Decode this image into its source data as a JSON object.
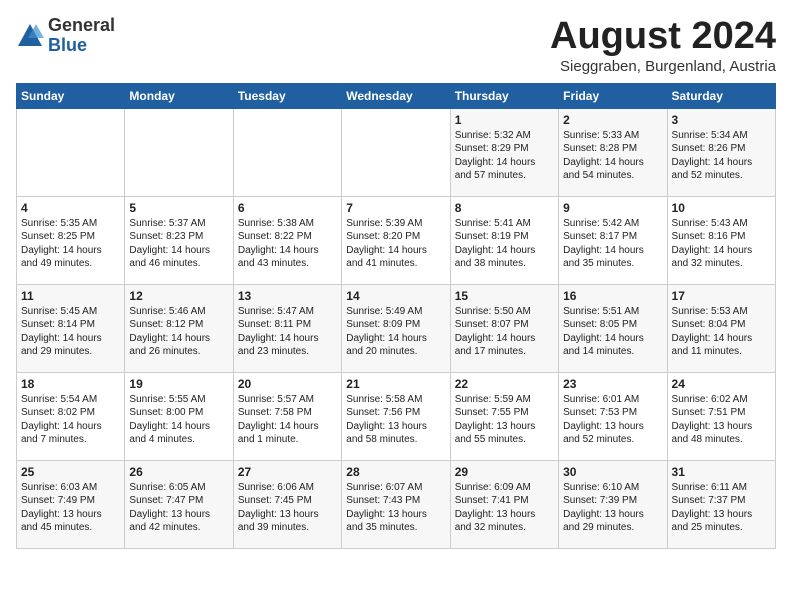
{
  "header": {
    "logo_general": "General",
    "logo_blue": "Blue",
    "month_title": "August 2024",
    "location": "Sieggraben, Burgenland, Austria"
  },
  "weekdays": [
    "Sunday",
    "Monday",
    "Tuesday",
    "Wednesday",
    "Thursday",
    "Friday",
    "Saturday"
  ],
  "weeks": [
    [
      {
        "day": "",
        "content": ""
      },
      {
        "day": "",
        "content": ""
      },
      {
        "day": "",
        "content": ""
      },
      {
        "day": "",
        "content": ""
      },
      {
        "day": "1",
        "content": "Sunrise: 5:32 AM\nSunset: 8:29 PM\nDaylight: 14 hours and 57 minutes."
      },
      {
        "day": "2",
        "content": "Sunrise: 5:33 AM\nSunset: 8:28 PM\nDaylight: 14 hours and 54 minutes."
      },
      {
        "day": "3",
        "content": "Sunrise: 5:34 AM\nSunset: 8:26 PM\nDaylight: 14 hours and 52 minutes."
      }
    ],
    [
      {
        "day": "4",
        "content": "Sunrise: 5:35 AM\nSunset: 8:25 PM\nDaylight: 14 hours and 49 minutes."
      },
      {
        "day": "5",
        "content": "Sunrise: 5:37 AM\nSunset: 8:23 PM\nDaylight: 14 hours and 46 minutes."
      },
      {
        "day": "6",
        "content": "Sunrise: 5:38 AM\nSunset: 8:22 PM\nDaylight: 14 hours and 43 minutes."
      },
      {
        "day": "7",
        "content": "Sunrise: 5:39 AM\nSunset: 8:20 PM\nDaylight: 14 hours and 41 minutes."
      },
      {
        "day": "8",
        "content": "Sunrise: 5:41 AM\nSunset: 8:19 PM\nDaylight: 14 hours and 38 minutes."
      },
      {
        "day": "9",
        "content": "Sunrise: 5:42 AM\nSunset: 8:17 PM\nDaylight: 14 hours and 35 minutes."
      },
      {
        "day": "10",
        "content": "Sunrise: 5:43 AM\nSunset: 8:16 PM\nDaylight: 14 hours and 32 minutes."
      }
    ],
    [
      {
        "day": "11",
        "content": "Sunrise: 5:45 AM\nSunset: 8:14 PM\nDaylight: 14 hours and 29 minutes."
      },
      {
        "day": "12",
        "content": "Sunrise: 5:46 AM\nSunset: 8:12 PM\nDaylight: 14 hours and 26 minutes."
      },
      {
        "day": "13",
        "content": "Sunrise: 5:47 AM\nSunset: 8:11 PM\nDaylight: 14 hours and 23 minutes."
      },
      {
        "day": "14",
        "content": "Sunrise: 5:49 AM\nSunset: 8:09 PM\nDaylight: 14 hours and 20 minutes."
      },
      {
        "day": "15",
        "content": "Sunrise: 5:50 AM\nSunset: 8:07 PM\nDaylight: 14 hours and 17 minutes."
      },
      {
        "day": "16",
        "content": "Sunrise: 5:51 AM\nSunset: 8:05 PM\nDaylight: 14 hours and 14 minutes."
      },
      {
        "day": "17",
        "content": "Sunrise: 5:53 AM\nSunset: 8:04 PM\nDaylight: 14 hours and 11 minutes."
      }
    ],
    [
      {
        "day": "18",
        "content": "Sunrise: 5:54 AM\nSunset: 8:02 PM\nDaylight: 14 hours and 7 minutes."
      },
      {
        "day": "19",
        "content": "Sunrise: 5:55 AM\nSunset: 8:00 PM\nDaylight: 14 hours and 4 minutes."
      },
      {
        "day": "20",
        "content": "Sunrise: 5:57 AM\nSunset: 7:58 PM\nDaylight: 14 hours and 1 minute."
      },
      {
        "day": "21",
        "content": "Sunrise: 5:58 AM\nSunset: 7:56 PM\nDaylight: 13 hours and 58 minutes."
      },
      {
        "day": "22",
        "content": "Sunrise: 5:59 AM\nSunset: 7:55 PM\nDaylight: 13 hours and 55 minutes."
      },
      {
        "day": "23",
        "content": "Sunrise: 6:01 AM\nSunset: 7:53 PM\nDaylight: 13 hours and 52 minutes."
      },
      {
        "day": "24",
        "content": "Sunrise: 6:02 AM\nSunset: 7:51 PM\nDaylight: 13 hours and 48 minutes."
      }
    ],
    [
      {
        "day": "25",
        "content": "Sunrise: 6:03 AM\nSunset: 7:49 PM\nDaylight: 13 hours and 45 minutes."
      },
      {
        "day": "26",
        "content": "Sunrise: 6:05 AM\nSunset: 7:47 PM\nDaylight: 13 hours and 42 minutes."
      },
      {
        "day": "27",
        "content": "Sunrise: 6:06 AM\nSunset: 7:45 PM\nDaylight: 13 hours and 39 minutes."
      },
      {
        "day": "28",
        "content": "Sunrise: 6:07 AM\nSunset: 7:43 PM\nDaylight: 13 hours and 35 minutes."
      },
      {
        "day": "29",
        "content": "Sunrise: 6:09 AM\nSunset: 7:41 PM\nDaylight: 13 hours and 32 minutes."
      },
      {
        "day": "30",
        "content": "Sunrise: 6:10 AM\nSunset: 7:39 PM\nDaylight: 13 hours and 29 minutes."
      },
      {
        "day": "31",
        "content": "Sunrise: 6:11 AM\nSunset: 7:37 PM\nDaylight: 13 hours and 25 minutes."
      }
    ]
  ]
}
